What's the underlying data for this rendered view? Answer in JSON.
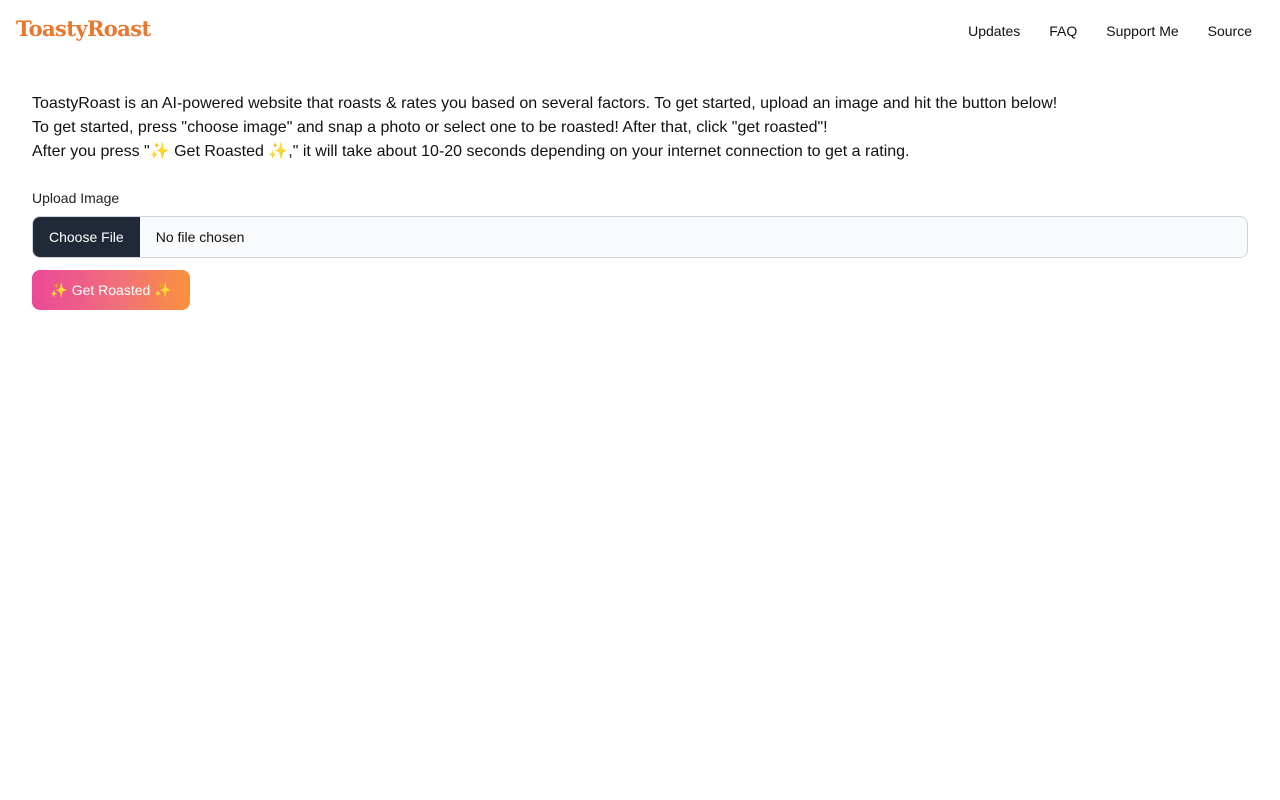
{
  "header": {
    "logo": "ToastyRoast",
    "nav": [
      {
        "label": "Updates"
      },
      {
        "label": "FAQ"
      },
      {
        "label": "Support Me"
      },
      {
        "label": "Source"
      }
    ]
  },
  "intro": {
    "lines": [
      "ToastyRoast is an AI-powered website that roasts & rates you based on several factors. To get started, upload an image and hit the button below!",
      "To get started, press \"choose image\" and snap a photo or select one to be roasted! After that, click \"get roasted\"!",
      "After you press \"✨ Get Roasted ✨,\" it will take about 10-20 seconds depending on your internet connection to get a rating."
    ]
  },
  "upload": {
    "label": "Upload Image",
    "choose_button": "Choose File",
    "status": "No file chosen"
  },
  "submit": {
    "label": "✨ Get Roasted ✨"
  },
  "colors": {
    "logo": "#e8772f",
    "file_button_bg": "#1f2937",
    "gradient_start": "#ec4899",
    "gradient_end": "#fb923c"
  }
}
